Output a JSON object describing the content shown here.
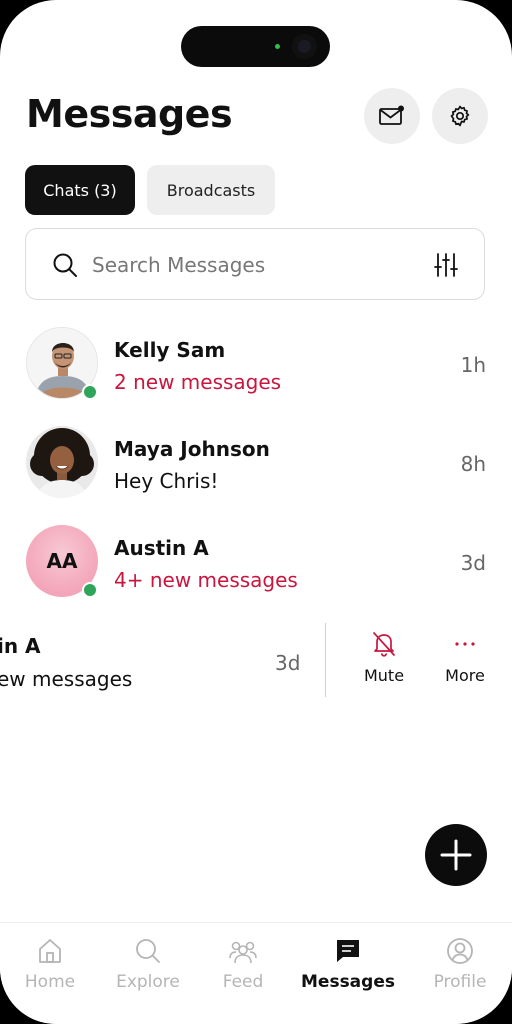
{
  "header": {
    "title": "Messages",
    "mail_icon": "mail-with-dot-icon",
    "settings_icon": "gear-icon"
  },
  "tabs": [
    {
      "label": "Chats (3)",
      "active": true
    },
    {
      "label": "Broadcasts",
      "active": false
    }
  ],
  "search": {
    "placeholder": "Search Messages",
    "icon": "search-icon",
    "filter_icon": "sliders-icon"
  },
  "chats": [
    {
      "name": "Kelly Sam",
      "preview": "2 new messages",
      "time": "1h",
      "unread": true,
      "online": true,
      "avatar": "photo"
    },
    {
      "name": "Maya Johnson",
      "preview": "Hey Chris!",
      "time": "8h",
      "unread": false,
      "online": false,
      "avatar": "photo"
    },
    {
      "name": "Austin A",
      "preview": "4+ new messages",
      "time": "3d",
      "unread": true,
      "online": true,
      "avatar": "AA"
    }
  ],
  "swiped_row": {
    "name": "in A",
    "preview": "ew messages",
    "time": "3d",
    "actions": [
      {
        "label": "Mute",
        "icon": "bell-off-icon"
      },
      {
        "label": "More",
        "icon": "ellipsis-icon"
      }
    ]
  },
  "fab": {
    "icon": "plus-icon"
  },
  "bottom_nav": [
    {
      "label": "Home",
      "icon": "home-icon",
      "active": false
    },
    {
      "label": "Explore",
      "icon": "search-icon",
      "active": false
    },
    {
      "label": "Feed",
      "icon": "people-icon",
      "active": false
    },
    {
      "label": "Messages",
      "icon": "chat-bubble-icon",
      "active": true
    },
    {
      "label": "Profile",
      "icon": "user-circle-icon",
      "active": false
    }
  ],
  "colors": {
    "unread": "#c8163f",
    "online": "#2ea55b",
    "active_tab": "#111111",
    "inactive": "#b5b5b5"
  }
}
